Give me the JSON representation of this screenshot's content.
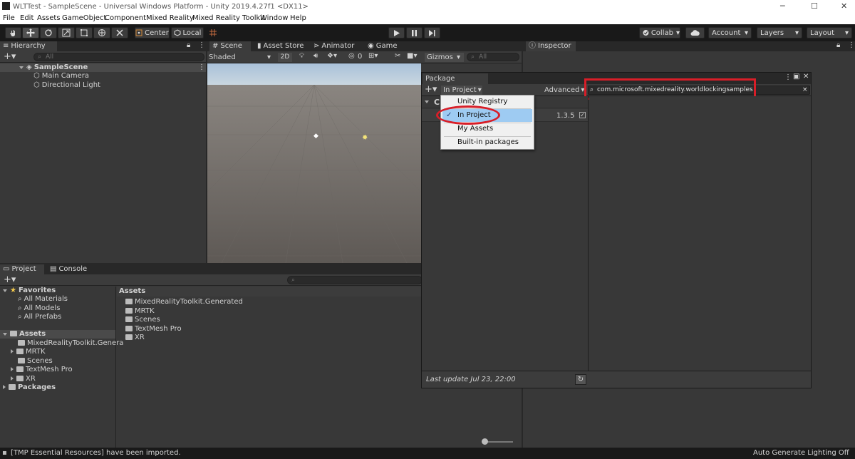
{
  "window": {
    "title": "WLTTest - SampleScene - Universal Windows Platform - Unity 2019.4.27f1 <DX11>",
    "minimize": "─",
    "maximize": "☐",
    "close": "✕"
  },
  "menu": [
    "File",
    "Edit",
    "Assets",
    "GameObject",
    "Component",
    "Mixed Reality",
    "Mixed Reality Toolkit",
    "Window",
    "Help"
  ],
  "toolbar": {
    "center": "Center",
    "local": "Local",
    "collab": "Collab",
    "account": "Account",
    "layers": "Layers",
    "layout": "Layout"
  },
  "hierarchy": {
    "tab": "Hierarchy",
    "search_placeholder": "All",
    "scene": "SampleScene",
    "items": [
      "Main Camera",
      "Directional Light"
    ]
  },
  "scene_view": {
    "tabs": [
      "Scene",
      "Asset Store",
      "Animator",
      "Game"
    ],
    "shading": "Shaded",
    "mode_2d": "2D",
    "hidden_count": "0",
    "gizmos": "Gizmos",
    "search_placeholder": "All"
  },
  "inspector": {
    "tab": "Inspector"
  },
  "project": {
    "tabs": [
      "Project",
      "Console"
    ],
    "favorites": "Favorites",
    "favorite_items": [
      "All Materials",
      "All Models",
      "All Prefabs"
    ],
    "assets_root": "Assets",
    "asset_folders": [
      "MixedRealityToolkit.Generated",
      "MRTK",
      "Scenes",
      "TextMesh Pro",
      "XR"
    ],
    "tree_assets": [
      "MixedRealityToolkit.Genera",
      "MRTK",
      "Scenes",
      "TextMesh Pro",
      "XR"
    ],
    "packages": "Packages",
    "content_header": "Assets"
  },
  "package_manager": {
    "title": "Package Manager",
    "filter": "In Project",
    "advanced": "Advanced",
    "search_value": "com.microsoft.mixedreality.worldlockingsamples",
    "clear": "×",
    "group_initial": "C",
    "package_version": "1.3.5",
    "last_update": "Last update Jul 23, 22:00",
    "dropdown": [
      "Unity Registry",
      "In Project",
      "My Assets",
      "Built-in packages"
    ],
    "selected_option": "In Project"
  },
  "status": {
    "message": "[TMP Essential Resources] have been imported.",
    "right": "Auto Generate Lighting Off"
  },
  "colors": {
    "highlight_red": "#d81e28",
    "menu_highlight": "#9ecbf2",
    "editor_dark": "#383838"
  }
}
